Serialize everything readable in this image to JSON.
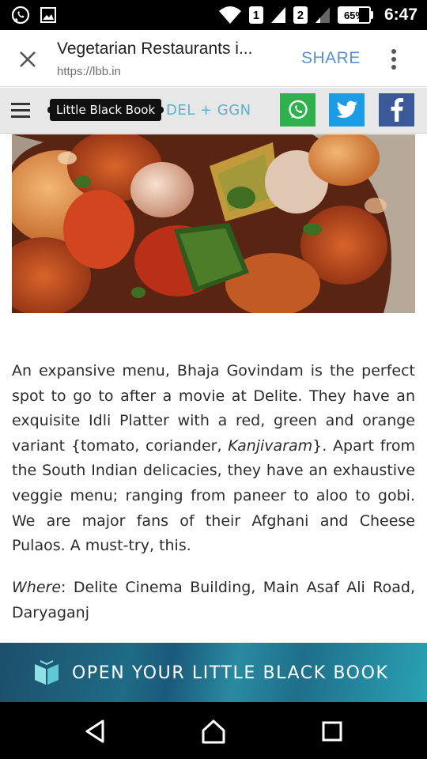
{
  "status_bar": {
    "icons": [
      "whatsapp-icon",
      "image-icon",
      "wifi-icon",
      "signal-icon",
      "signal-icon"
    ],
    "sim1": "1",
    "sim2": "2",
    "battery": "65%",
    "battery_level": 0.65,
    "time": "6:47"
  },
  "toolbar": {
    "title": "Vegetarian Restaurants i...",
    "url": "https://lbb.in",
    "share_label": "SHARE",
    "close_icon": "close-icon",
    "menu_icon": "more-vert-icon"
  },
  "site_header": {
    "logo_text": "Little Black Book",
    "city": "DEL + GGN",
    "social": [
      "whatsapp-icon",
      "twitter-icon",
      "facebook-icon"
    ],
    "colors": {
      "whatsapp": "#2fb24d",
      "twitter": "#1d9ce6",
      "facebook": "#3b5998",
      "city": "#5ab3c8"
    }
  },
  "article": {
    "p1_a": "An expansive menu, Bhaja Govindam is the perfect spot to go to after a movie at Delite. They have an exquisite Idli Platter with a red, green and orange variant {tomato, coriander, ",
    "p1_em": "Kanjivaram",
    "p1_b": "}. Apart from the South Indian delicacies, they have an exhaustive veggie menu; ranging from paneer to aloo to gobi. We are major fans of their Afghani and Cheese Pulaos. A must-try, this.",
    "where_label": "Where",
    "where_text": ": Delite Cinema Building, Main Asaf Ali Road, Daryaganj"
  },
  "banner": {
    "text": "OPEN YOUR LITTLE BLACK BOOK",
    "icon": "book-icon"
  },
  "navbar": {
    "icons": [
      "back-icon",
      "home-icon",
      "recents-icon"
    ]
  }
}
